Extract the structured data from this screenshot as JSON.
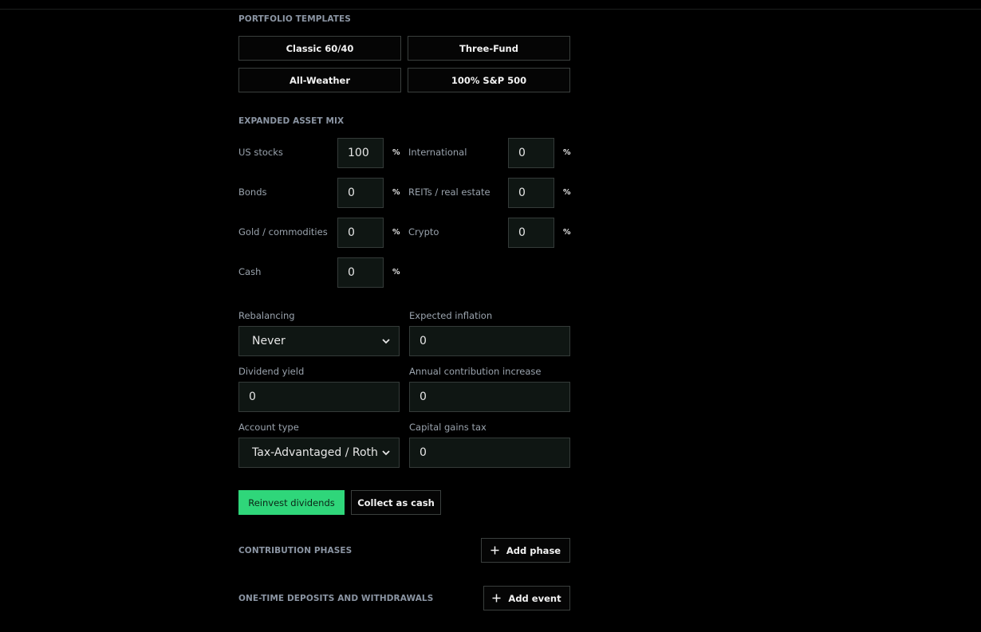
{
  "templates": {
    "title": "PORTFOLIO TEMPLATES",
    "items": [
      "Classic 60/40",
      "Three-Fund",
      "All-Weather",
      "100% S&P 500"
    ]
  },
  "asset_mix": {
    "title": "EXPANDED ASSET MIX",
    "percent_symbol": "%",
    "assets": [
      {
        "label": "US stocks",
        "value": "100"
      },
      {
        "label": "International",
        "value": "0"
      },
      {
        "label": "Bonds",
        "value": "0"
      },
      {
        "label": "REITs / real estate",
        "value": "0"
      },
      {
        "label": "Gold / commodities",
        "value": "0"
      },
      {
        "label": "Crypto",
        "value": "0"
      },
      {
        "label": "Cash",
        "value": "0"
      }
    ]
  },
  "settings": {
    "rebalancing": {
      "label": "Rebalancing",
      "value": "Never"
    },
    "expected_inflation": {
      "label": "Expected inflation",
      "value": "0"
    },
    "dividend_yield": {
      "label": "Dividend yield",
      "value": "0"
    },
    "annual_contribution_increase": {
      "label": "Annual contribution increase",
      "value": "0"
    },
    "account_type": {
      "label": "Account type",
      "value": "Tax-Advantaged / Roth"
    },
    "capital_gains_tax": {
      "label": "Capital gains tax",
      "value": "0"
    }
  },
  "dividends": {
    "reinvest_label": "Reinvest dividends",
    "collect_label": "Collect as cash",
    "selected": "reinvest"
  },
  "contribution_phases": {
    "title": "CONTRIBUTION PHASES",
    "add_label": "Add phase"
  },
  "one_time": {
    "title": "ONE-TIME DEPOSITS AND WITHDRAWALS",
    "add_label": "Add event"
  },
  "colors": {
    "background": "#000000",
    "accent": "#2fd67a",
    "input_bg": "#0f1613",
    "border": "#3a3f3d",
    "muted_text": "#9aa3ad"
  }
}
